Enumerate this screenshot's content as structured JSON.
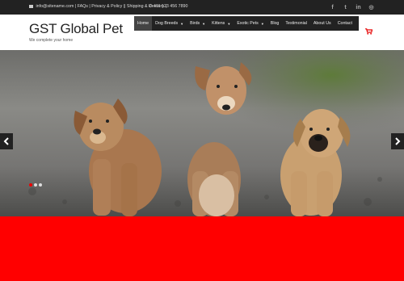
{
  "topbar": {
    "contact_text": "info@sitename.com | FAQs | Privacy & Policy || Shipping & Delivery |",
    "phone": "+11 123 456 7890"
  },
  "header": {
    "brand": "GST Global Pet",
    "tagline": "We complete your home"
  },
  "nav": {
    "items": [
      {
        "label": "Home"
      },
      {
        "label": "Dog Breeds"
      },
      {
        "label": "Birds"
      },
      {
        "label": "Kittens"
      },
      {
        "label": "Exotic Pets"
      },
      {
        "label": "Blog"
      },
      {
        "label": "Testimonial"
      },
      {
        "label": "About Us"
      },
      {
        "label": "Contact"
      }
    ]
  },
  "social_icons": [
    "facebook-icon",
    "twitter-icon",
    "linkedin-icon",
    "instagram-icon"
  ],
  "slider": {
    "image": "three-puppies-on-gravel",
    "active_dot": 1,
    "dot_count": 3
  },
  "colors": {
    "topbar": "#222222",
    "nav": "#222222",
    "accent": "#ff0000"
  }
}
